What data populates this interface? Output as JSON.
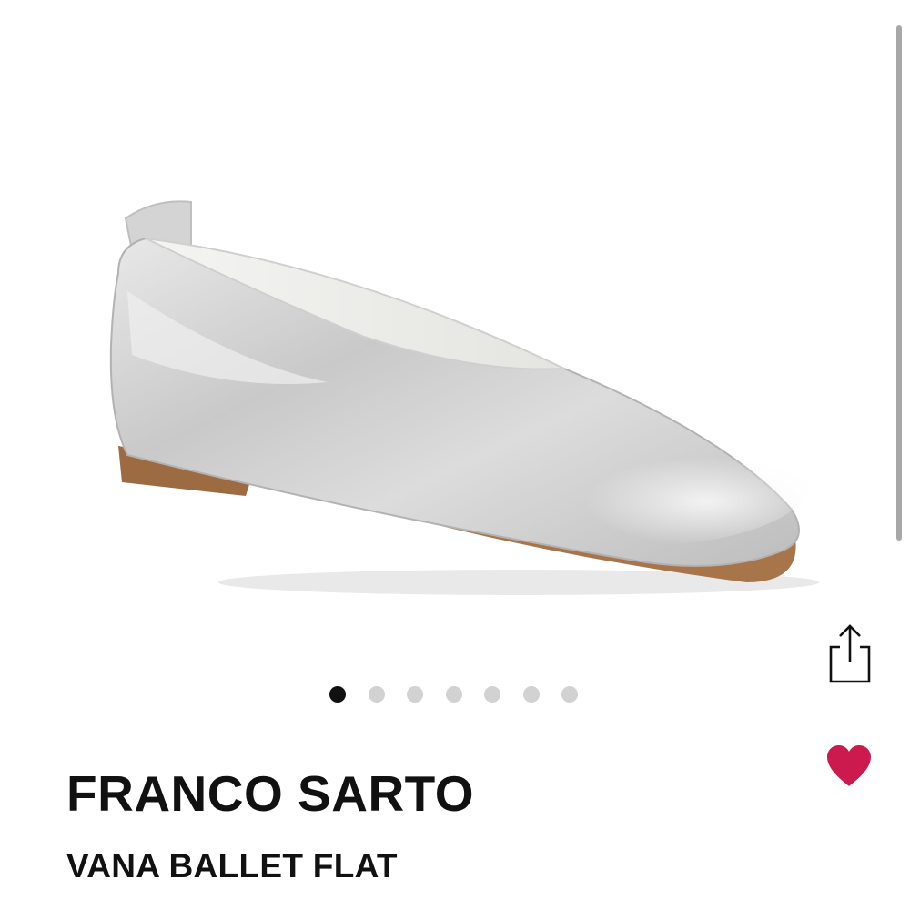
{
  "product": {
    "brand": "FRANCO SARTO",
    "name": "VANA BALLET FLAT",
    "image_icon": "silver-ballet-flat-image"
  },
  "carousel": {
    "total": 7,
    "active_index": 0
  },
  "actions": {
    "share_icon": "share-icon",
    "favorite_icon": "heart-icon",
    "favorite_active": true
  },
  "colors": {
    "heart": "#cc1a4e",
    "dot_active": "#111111",
    "dot_inactive": "#d2d2d2",
    "text": "#111111"
  }
}
